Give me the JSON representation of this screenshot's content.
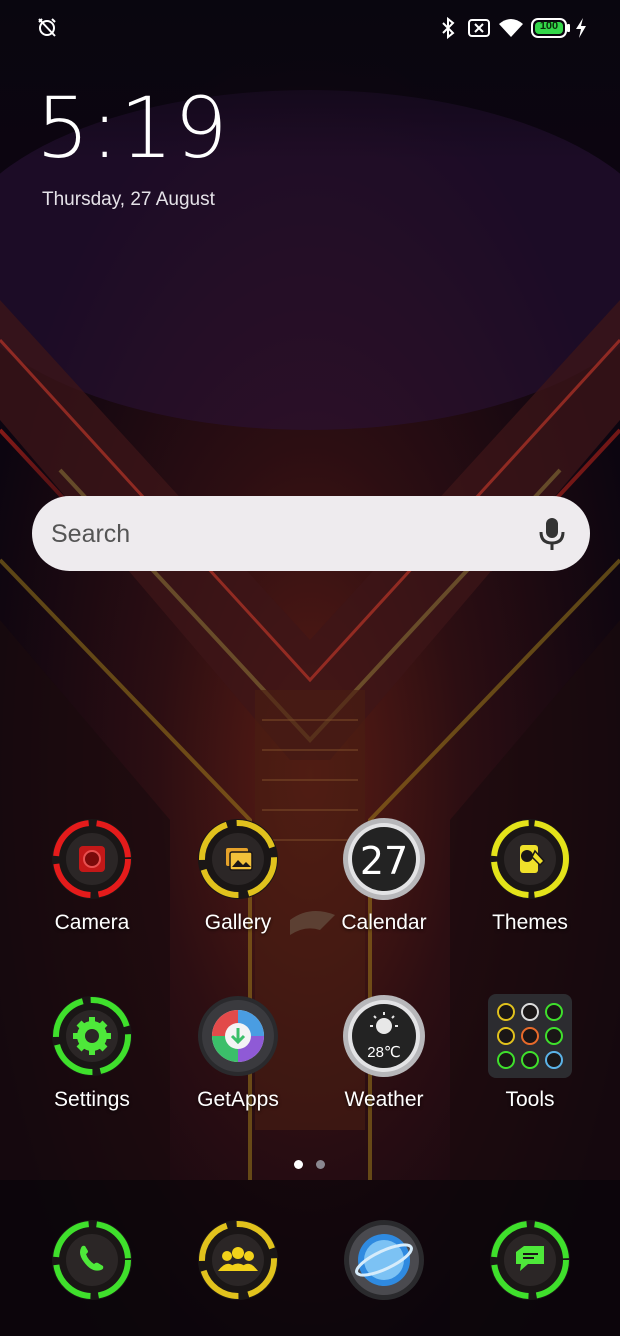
{
  "status_bar": {
    "left_icons": [
      "alarm-off-icon"
    ],
    "right_icons": [
      "bluetooth-icon",
      "no-sim-icon",
      "wifi-icon",
      "battery-icon",
      "charging-bolt-icon"
    ],
    "battery_level": "100",
    "battery_color": "#34d74a"
  },
  "lockscreen": {
    "time": "5:19",
    "date": "Thursday, 27 August"
  },
  "search": {
    "placeholder": "Search",
    "icon": "mic-icon"
  },
  "apps_row1": [
    {
      "label": "Camera",
      "icon": "camera-icon",
      "ring": "#e51b1b"
    },
    {
      "label": "Gallery",
      "icon": "gallery-icon",
      "ring": "#e1c21d"
    },
    {
      "label": "Calendar",
      "icon": "calendar-icon",
      "day": "27"
    },
    {
      "label": "Themes",
      "icon": "themes-icon",
      "ring": "#e4e31a"
    }
  ],
  "apps_row2": [
    {
      "label": "Settings",
      "icon": "gear-icon",
      "ring": "#3fe02c"
    },
    {
      "label": "GetApps",
      "icon": "getapps-icon"
    },
    {
      "label": "Weather",
      "icon": "weather-icon",
      "temp": "28℃"
    },
    {
      "label": "Tools",
      "icon": "tools-folder-icon"
    }
  ],
  "dock": [
    {
      "icon": "phone-icon",
      "ring": "#3fe02c"
    },
    {
      "icon": "contacts-icon",
      "ring": "#e1c21d"
    },
    {
      "icon": "browser-icon"
    },
    {
      "icon": "messages-icon",
      "ring": "#3fe02c"
    }
  ],
  "page_indicator": {
    "pages": 2,
    "current": 1
  }
}
